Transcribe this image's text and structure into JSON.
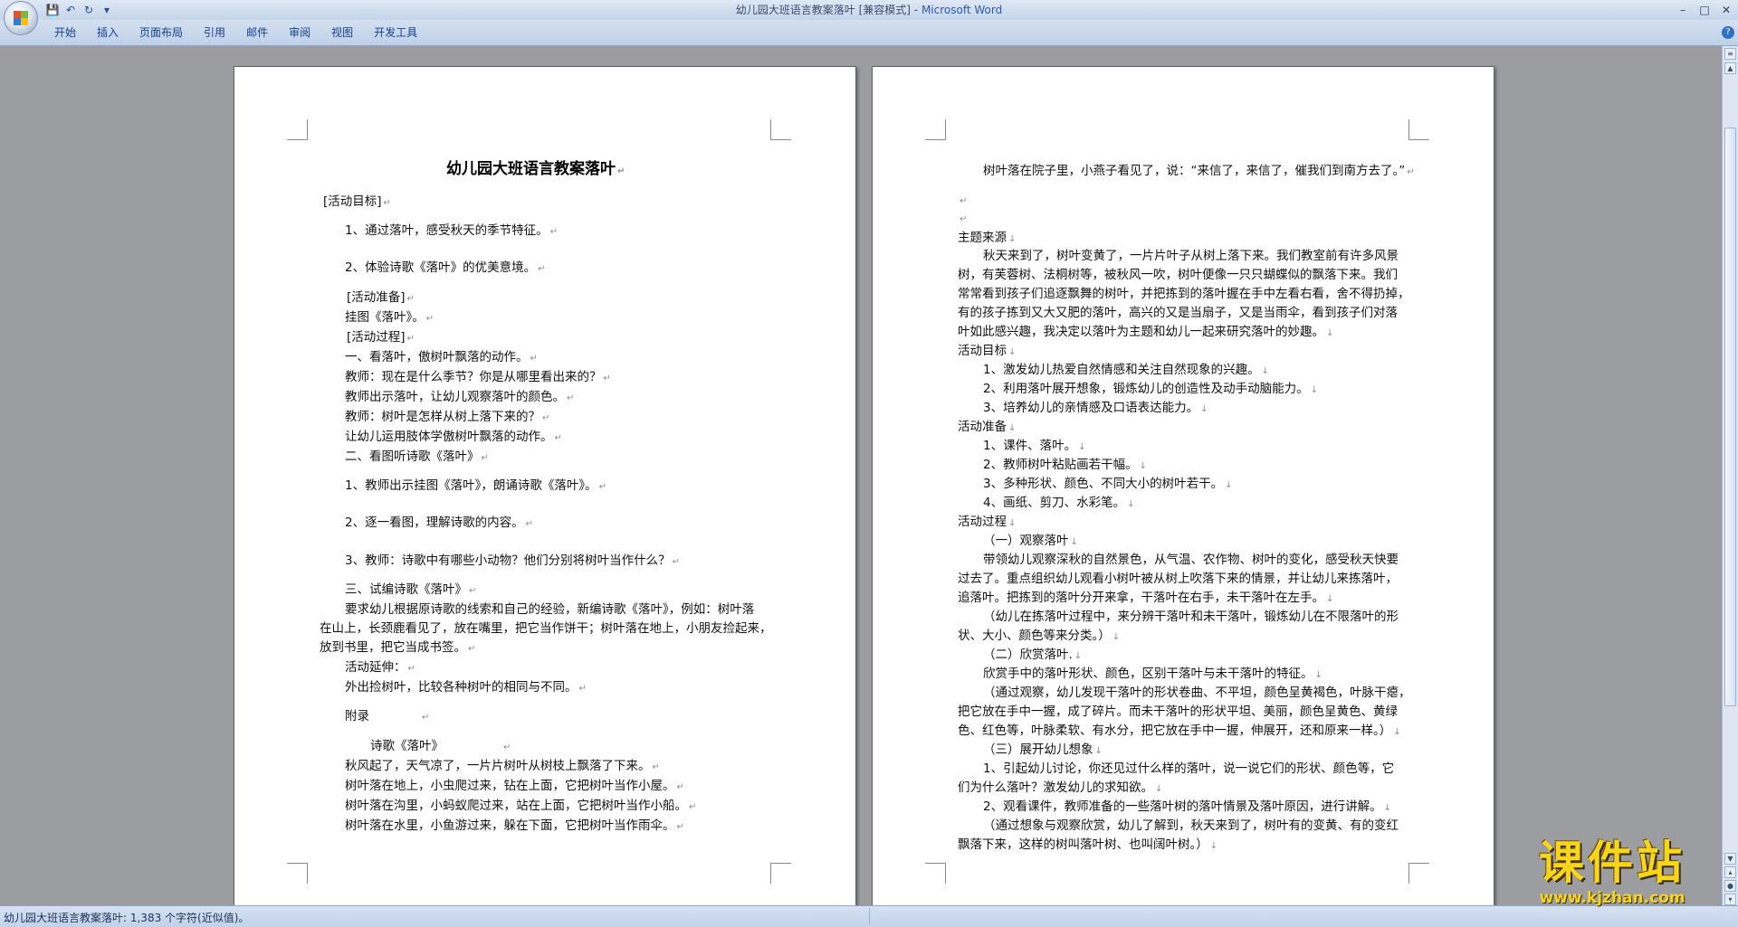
{
  "window": {
    "title": "幼儿园大班语言教案落叶 [兼容模式]",
    "app_name": "Microsoft Word",
    "controls": [
      "–",
      "□",
      "✕"
    ]
  },
  "quick_access": [
    "save-icon",
    "undo-icon",
    "redo-icon",
    "customize-icon"
  ],
  "ribbon": {
    "tabs": [
      "开始",
      "插入",
      "页面布局",
      "引用",
      "邮件",
      "审阅",
      "视图",
      "开发工具"
    ]
  },
  "pages": [
    {
      "title": "幼儿园大班语言教案落叶",
      "lines": [
        "[活动目标]",
        "1、通过落叶，感受秋天的季节特征。",
        "2、体验诗歌《落叶》的优美意境。",
        "[活动准备]",
        "挂图《落叶》。",
        "[活动过程]",
        "一、看落叶，傲树叶飘落的动作。",
        "教师：现在是什么季节？你是从哪里看出来的？",
        "教师出示落叶，让幼儿观察落叶的颜色。",
        "教师：树叶是怎样从树上落下来的？",
        "让幼儿运用肢体学傲树叶飘落的动作。",
        "二、看图听诗歌《落叶》",
        "1、教师出示挂图《落叶》，朗诵诗歌《落叶》。",
        "2、逐一看图，理解诗歌的内容。",
        "3、教师：诗歌中有哪些小动物？他们分别将树叶当作什么？",
        "三、试编诗歌《落叶》",
        "要求幼儿根据原诗歌的线索和自己的经验，新编诗歌《落叶》，例如：树叶落",
        "在山上，长颈鹿看见了，放在嘴里，把它当作饼干；树叶落在地上，小朋友捡起来，",
        "放到书里，把它当成书签。",
        "活动延伸：",
        "外出捡树叶，比较各种树叶的相同与不同。",
        "附录",
        "诗歌《落叶》",
        "秋风起了，天气凉了，一片片树叶从树枝上飘落了下来。",
        "树叶落在地上，小虫爬过来，钻在上面，它把树叶当作小屋。",
        "树叶落在沟里，小蚂蚁爬过来，站在上面，它把树叶当作小船。",
        "树叶落在水里，小鱼游过来，躲在下面，它把树叶当作雨伞。"
      ]
    },
    {
      "lines": [
        "树叶落在院子里，小燕子看见了，说：“来信了，来信了，催我们到南方去了。”",
        "主题来源",
        "秋天来到了，树叶变黄了，一片片叶子从树上落下来。我们教室前有许多风景",
        "树，有芙蓉树、法桐树等，被秋风一吹，树叶便像一只只蝴蝶似的飘落下来。我们",
        "常常看到孩子们追逐飘舞的树叶，并把拣到的落叶握在手中左看右看，舍不得扔掉，",
        "有的孩子拣到又大又肥的落叶，高兴的又是当扇子，又是当雨伞，看到孩子们对落",
        "叶如此感兴趣，我决定以落叶为主题和幼儿一起来研究落叶的妙趣。",
        "活动目标",
        "1、激发幼儿热爱自然情感和关注自然现象的兴趣。",
        "2、利用落叶展开想象，锻炼幼儿的创造性及动手动脑能力。",
        "3、培养幼儿的亲情感及口语表达能力。",
        "活动准备",
        "1、课件、落叶。",
        "2、教师树叶粘贴画若干幅。",
        "3、多种形状、颜色、不同大小的树叶若干。",
        "4、画纸、剪刀、水彩笔。",
        "活动过程",
        "（一）观察落叶",
        "带领幼儿观察深秋的自然景色，从气温、农作物、树叶的变化，感受秋天快要",
        "过去了。重点组织幼儿观看小树叶被从树上吹落下来的情景，并让幼儿来拣落叶，",
        "追落叶。把拣到的落叶分开来拿，干落叶在右手，未干落叶在左手。",
        "（幼儿在拣落叶过程中，来分辨干落叶和未干落叶，锻炼幼儿在不限落叶的形",
        "状、大小、颜色等来分类。）",
        "（二）欣赏落叶.",
        "欣赏手中的落叶形状、颜色，区别干落叶与未干落叶的特征。",
        "（通过观察，幼儿发现干落叶的形状卷曲、不平坦，颜色呈黄褐色，叶脉干瘪，",
        "把它放在手中一握，成了碎片。而未干落叶的形状平坦、美丽，颜色呈黄色、黄绿",
        "色、红色等，叶脉柔软、有水分，把它放在手中一握，伸展开，还和原来一样。）",
        "（三）展开幼儿想象",
        "1、引起幼儿讨论，你还见过什么样的落叶，说一说它们的形状、颜色等，它",
        "们为什么落叶？激发幼儿的求知欲。",
        "2、观看课件，教师准备的一些落叶树的落叶情景及落叶原因，进行讲解。",
        "（通过想象与观察欣赏，幼儿了解到，秋天来到了，树叶有的变黄、有的变红",
        "飘落下来，这样的树叫落叶树、也叫阔叶树。）"
      ]
    }
  ],
  "statusbar": {
    "text": "幼儿园大班语言教案落叶: 1,383 个字符(近似值)。"
  },
  "watermark": {
    "title": "课件站",
    "url": "www.kjzhan.com"
  }
}
